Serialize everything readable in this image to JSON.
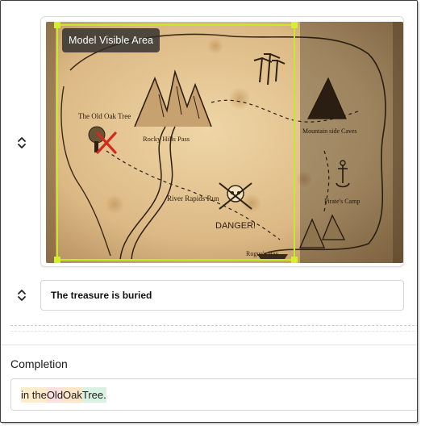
{
  "prompt_section": {
    "image": {
      "overlay_label": "Model Visible Area",
      "map_labels": {
        "old_oak_tree": "The Old Oak Tree",
        "rocky_hills_pass": "Rocky Hills Pass",
        "river_rapids_run": "River Rapids Run",
        "danger": "DANGER!",
        "rogues_bay": "Rogue's Bay",
        "mountain_side_caves": "Mountain side Caves",
        "pirates_camp": "Pirate's Camp"
      }
    },
    "text_input": {
      "value": "The treasure is buried"
    }
  },
  "completion": {
    "title": "Completion",
    "tokens": [
      "in the ",
      "Old ",
      "Oak ",
      "Tree."
    ]
  },
  "colors": {
    "visible_area_outline": "#c8e62a",
    "map_base": "#e2c594",
    "token_highlights": [
      "#fbeccc",
      "#fbe0dd",
      "#fbe7c8",
      "#d9f1e0"
    ]
  }
}
